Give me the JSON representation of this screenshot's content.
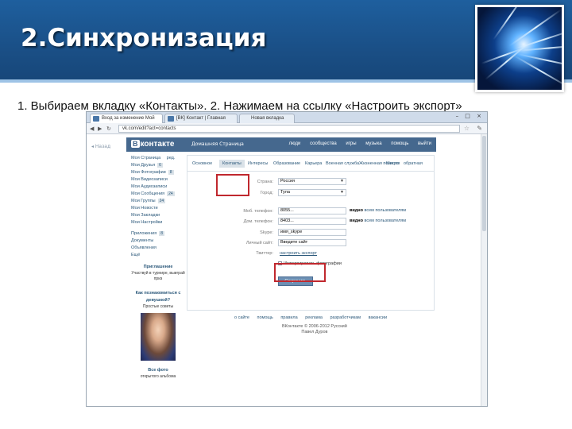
{
  "slide": {
    "title": "2.Синхронизация",
    "instruction": "1. Выбираем вкладку «Контакты». 2. Нажимаем на ссылку «Настроить экспорт»"
  },
  "browser": {
    "tabs": [
      "Вход за изменение Мой",
      "[ВК] Контакт | Главная",
      "Новая вкладка"
    ],
    "url": "vk.com/edit?act=contacts",
    "window_controls": "– □ ×"
  },
  "vk": {
    "logo_badge": "В",
    "logo_text": "контакте",
    "home_label": "Домашняя Страница",
    "nav": [
      "люди",
      "сообщества",
      "игры",
      "музыка",
      "помощь",
      "выйти"
    ],
    "back_label": "◂ Назад",
    "menu": [
      {
        "label": "Моя Страница",
        "extra": "ред."
      },
      {
        "label": "Мои Друзья",
        "badge": "6"
      },
      {
        "label": "Мои Фотографии",
        "badge": "8"
      },
      {
        "label": "Мои Видеозаписи"
      },
      {
        "label": "Мои Аудиозаписи"
      },
      {
        "label": "Мои Сообщения",
        "badge": "24"
      },
      {
        "label": "Мои Группы",
        "badge": "24"
      },
      {
        "label": "Мои Новости"
      },
      {
        "label": "Мои Закладки"
      },
      {
        "label": "Мои Настройки"
      }
    ],
    "menu2": [
      {
        "label": "Приложения",
        "badge": "8"
      },
      {
        "label": "Документы"
      },
      {
        "label": "Объявления"
      }
    ],
    "more": "Ещё",
    "ad1": {
      "title": "Приглашение",
      "text": "Участвуй в турнире, выиграй приз"
    },
    "ad2": {
      "title": "Как познакомиться с девушкой?",
      "text": "Простые советы"
    },
    "ad3": {
      "title": "Все фото",
      "text": "открытого альбома"
    },
    "profile_tabs": [
      "Основное",
      "Контакты",
      "Интересы",
      "Образование",
      "Карьера",
      "Военная служба",
      "Жизненная позиция",
      "Места",
      "обратная"
    ],
    "fields": {
      "country": {
        "label": "Страна:",
        "value": "Россия"
      },
      "city": {
        "label": "Город:",
        "value": "Тула"
      },
      "mobile": {
        "label": "Моб. телефон:",
        "value": "8055...",
        "note_prefix": "видно",
        "note": "всем пользователям"
      },
      "home_phone": {
        "label": "Дом. телефон:",
        "value": "8403...",
        "note_prefix": "видно",
        "note": "всем пользователям"
      },
      "skype": {
        "label": "Skype:",
        "value": "имя_skype"
      },
      "site": {
        "label": "Личный сайт:",
        "value": "Введите сайт"
      },
      "twitter": {
        "label": "Твиттер:",
        "link": "настроить экспорт"
      },
      "instagram_note": "Импортировать фотографии"
    },
    "save_button": "Сохранить",
    "footer_links": [
      "о сайте",
      "помощь",
      "правила",
      "реклама",
      "разработчикам",
      "вакансии"
    ],
    "copyright": "ВКонтакте © 2006-2012 Русский",
    "copyright2": "Павел Дуров"
  },
  "colors": {
    "header_bg": "#1a4f86",
    "vk_blue": "#45688e",
    "vk_link": "#2b587a",
    "highlight": "#c0282e"
  }
}
